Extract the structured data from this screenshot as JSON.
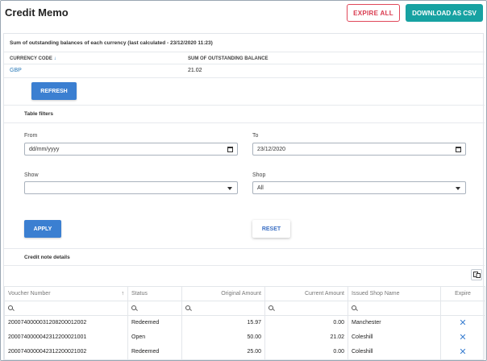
{
  "header": {
    "title": "Credit Memo",
    "expire_all_label": "EXPIRE ALL",
    "download_csv_label": "DOWNLOAD AS CSV"
  },
  "balances": {
    "heading": "Sum of outstanding balances of each currency (last calculated - 23/12/2020 11:23)",
    "col_currency": "CURRENCY CODE",
    "col_sum": "SUM OF OUTSTANDING BALANCE",
    "rows": [
      {
        "currency": "GBP",
        "sum": "21.02"
      }
    ],
    "refresh_label": "REFRESH"
  },
  "filters": {
    "heading": "Table filters",
    "from_label": "From",
    "from_value": "dd/mm/yyyy",
    "to_label": "To",
    "to_value": "23/12/2020",
    "show_label": "Show",
    "show_value": "",
    "shop_label": "Shop",
    "shop_value": "All",
    "apply_label": "APPLY",
    "reset_label": "RESET"
  },
  "credit_notes": {
    "heading": "Credit note details",
    "columns": [
      "Voucher Number",
      "Status",
      "Original Amount",
      "Current Amount",
      "Issued Shop Name",
      "Expire"
    ],
    "rows": [
      {
        "voucher": "2000740000031208200012002",
        "status": "Redeemed",
        "original": "15.97",
        "current": "0.00",
        "shop": "Manchester"
      },
      {
        "voucher": "2000740000042312200021001",
        "status": "Open",
        "original": "50.00",
        "current": "21.02",
        "shop": "Coleshill"
      },
      {
        "voucher": "2000740000042312200021002",
        "status": "Redeemed",
        "original": "25.00",
        "current": "0.00",
        "shop": "Coleshill"
      }
    ]
  },
  "colors": {
    "accent": "#3b7fd1",
    "csv": "#17a2a2",
    "expire": "#e0485a",
    "link": "#2a7ab8"
  }
}
